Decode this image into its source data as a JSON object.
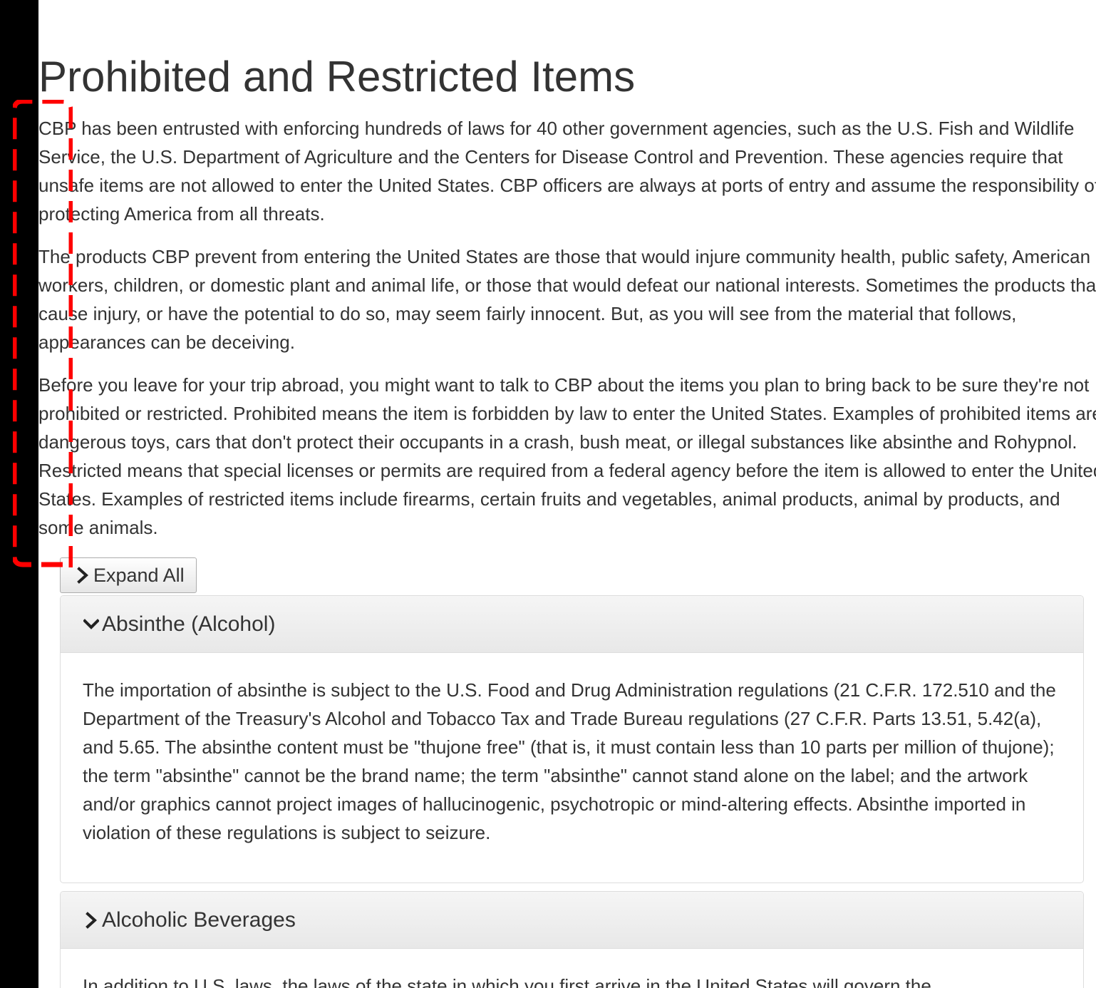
{
  "page": {
    "title": "Prohibited and Restricted Items",
    "intro": [
      "CBP has been entrusted with enforcing hundreds of laws for 40 other government agencies, such as the U.S. Fish and Wildlife Service, the U.S. Department of Agriculture and the Centers for Disease Control and Prevention. These agencies require that unsafe items are not allowed to enter the United States. CBP officers are always at ports of entry and assume the responsibility of protecting America from all threats.",
      "The products CBP prevent from entering the United States are those that would injure community health, public safety, American workers, children, or domestic plant and animal life, or those that would defeat our national interests. Sometimes the products that cause injury, or have the potential to do so, may seem fairly innocent. But, as you will see from the material that follows, appearances can be deceiving.",
      "Before you leave for your trip abroad, you might want to talk to CBP about the items you plan to bring back to be sure they're not prohibited or restricted. Prohibited means the item is forbidden by law to enter the United States. Examples of prohibited items are dangerous toys, cars that don't protect their occupants in a crash, bush meat, or illegal substances like absinthe and Rohypnol. Restricted means that special licenses or permits are required from a federal agency before the item is allowed to enter the United States. Examples of restricted items include firearms, certain fruits and vegetables, animal products, animal by products, and some animals."
    ]
  },
  "controls": {
    "expand_all_label": "Expand All"
  },
  "accordion": [
    {
      "title": "Absinthe (Alcohol)",
      "expanded": true,
      "icon": "chevron-down-icon",
      "body": "The importation of absinthe is subject to the U.S. Food and Drug Administration regulations (21 C.F.R. 172.510 and the Department of the Treasury's Alcohol and Tobacco Tax and Trade Bureau regulations (27 C.F.R. Parts 13.51, 5.42(a), and 5.65. The absinthe content must be \"thujone free\" (that is, it must contain less than 10 parts per million of thujone); the term \"absinthe\" cannot be the brand name; the term \"absinthe\" cannot stand alone on the label; and the artwork and/or graphics cannot project images of hallucinogenic, psychotropic or mind-altering effects. Absinthe imported in violation of these regulations is subject to seizure."
    },
    {
      "title": "Alcoholic Beverages",
      "expanded": false,
      "icon": "chevron-right-icon",
      "body": "In addition to U.S. laws, the laws of the state in which you first arrive in the United States will govern the"
    }
  ],
  "colors": {
    "text": "#333333",
    "sidebar": "#000000",
    "annotation": "#ff0000"
  }
}
